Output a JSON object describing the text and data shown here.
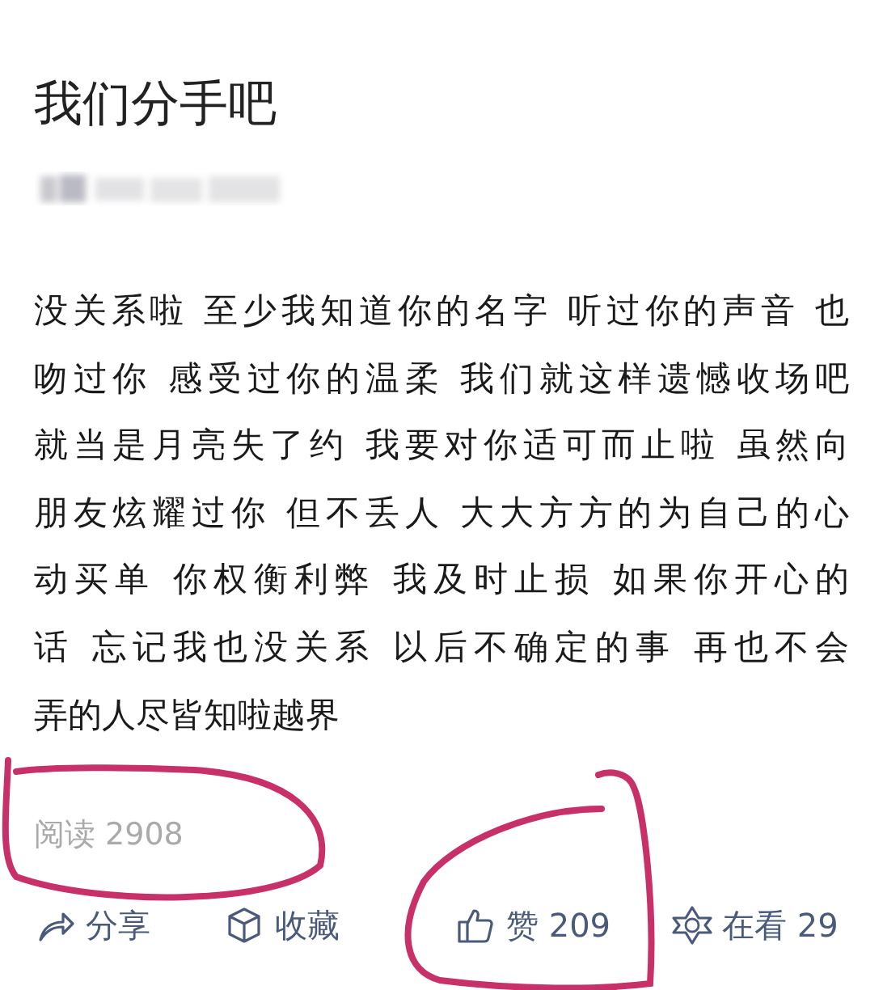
{
  "article": {
    "title": "我们分手吧",
    "body_lines": [
      "没关系啦 至少我知道你的名字 听过你的声音 也",
      "吻过你 感受过你的温柔 我们就这样遗憾收场吧",
      "就当是月亮失了约 我要对你适可而止啦 虽然向",
      "朋友炫耀过你  但不丢人  大大方方的为自己的心",
      "动买单  你权衡利弊  我及时止损 如果你开心的",
      "话  忘记我也没关系 以后不确定的事  再也不会",
      "弄的人尽皆知啦越界"
    ],
    "read_count": "阅读 2908"
  },
  "actions": [
    {
      "kind": "share",
      "label": "分享"
    },
    {
      "kind": "collect",
      "label": "收藏"
    },
    {
      "kind": "like",
      "label": "赞 209"
    },
    {
      "kind": "watching",
      "label": "在看 29"
    }
  ],
  "annotations": [
    {
      "kind": "pen-circle"
    },
    {
      "kind": "pen-circle"
    }
  ]
}
